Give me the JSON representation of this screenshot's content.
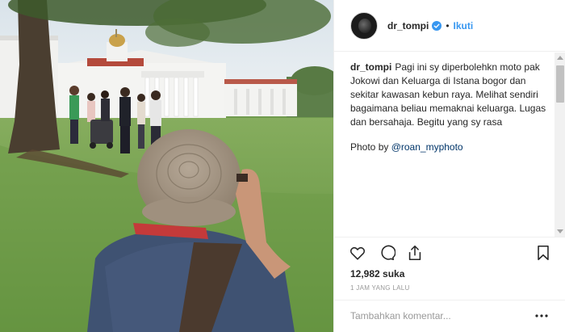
{
  "post": {
    "username": "dr_tompi",
    "follow_label": "Ikuti",
    "separator": "•",
    "caption_text": "Pagi ini sy diperbolehkn moto pak Jokowi dan Keluarga di Istana bogor dan sekitar kawasan kebun raya. Melihat sendiri bagaimana beliau memaknai keluarga. Lugas dan bersahaja. Begitu yang sy rasa",
    "photo_credit_prefix": "Photo by ",
    "photo_credit_mention": "@roan_myphoto",
    "likes_count": "12,982",
    "likes_label": "suka",
    "timestamp": "1 JAM YANG LALU",
    "comment_placeholder": "Tambahkan komentar..."
  },
  "icons": {
    "verified": "verified-badge-icon",
    "like": "heart-icon",
    "comment": "comment-icon",
    "share": "share-icon",
    "save": "bookmark-icon",
    "more": "more-options-icon"
  },
  "colors": {
    "link_blue": "#3897f0",
    "mention_blue": "#003569",
    "meta_gray": "#999999",
    "text": "#262626"
  }
}
